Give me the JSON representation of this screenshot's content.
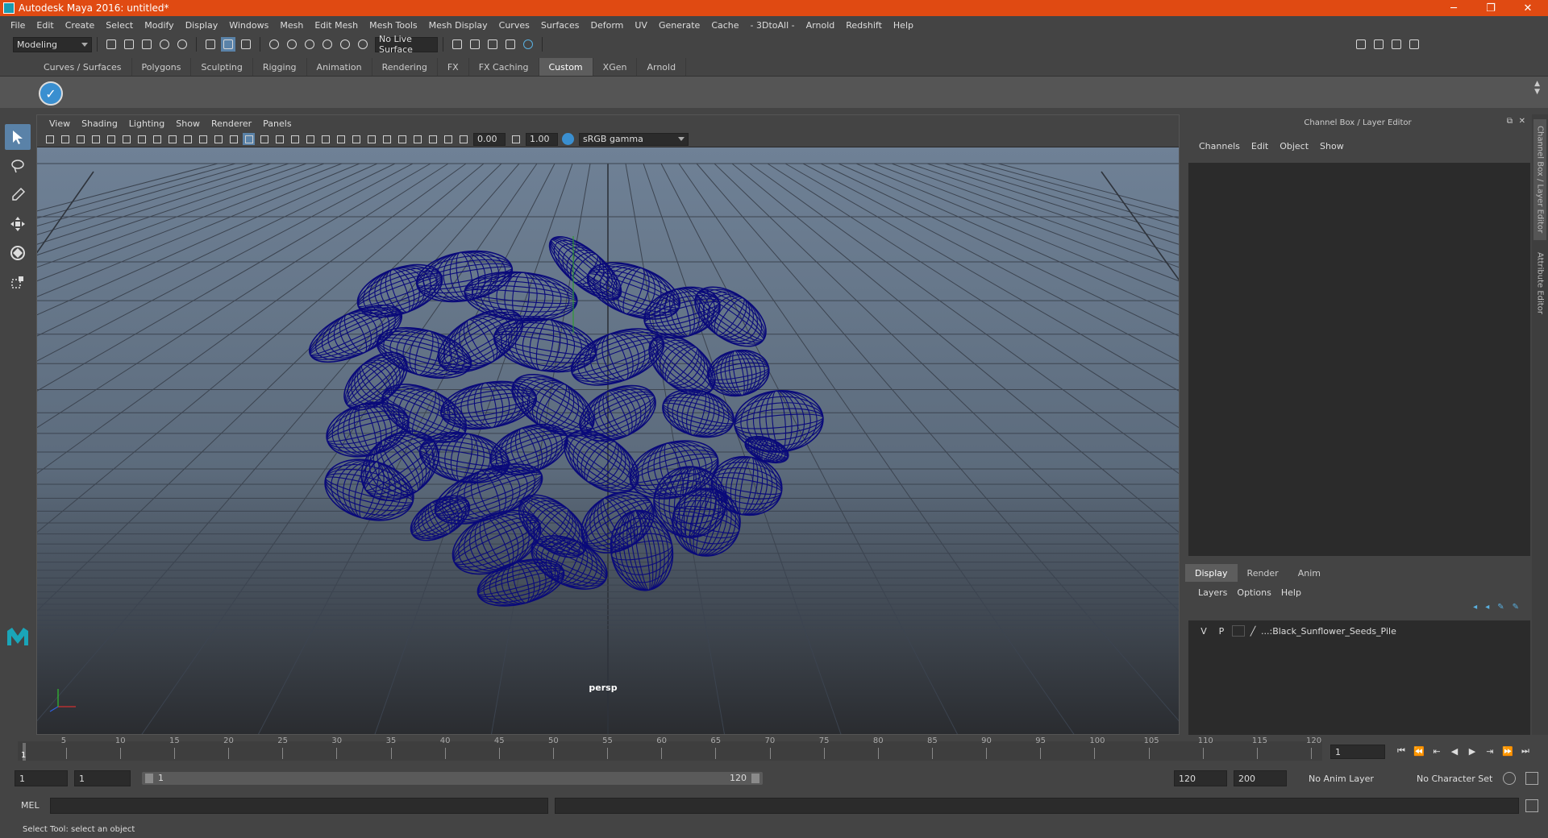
{
  "window": {
    "title": "Autodesk Maya 2016: untitled*",
    "minimize": "─",
    "maximize": "❐",
    "close": "✕"
  },
  "menubar": [
    "File",
    "Edit",
    "Create",
    "Select",
    "Modify",
    "Display",
    "Windows",
    "Mesh",
    "Edit Mesh",
    "Mesh Tools",
    "Mesh Display",
    "Curves",
    "Surfaces",
    "Deform",
    "UV",
    "Generate",
    "Cache",
    "- 3DtoAll -",
    "Arnold",
    "Redshift",
    "Help"
  ],
  "statusline": {
    "mode": "Modeling",
    "live_surface": "No Live Surface"
  },
  "shelf": {
    "tabs": [
      "Curves / Surfaces",
      "Polygons",
      "Sculpting",
      "Rigging",
      "Animation",
      "Rendering",
      "FX",
      "FX Caching",
      "Custom",
      "XGen",
      "Arnold"
    ],
    "active_tab": "Custom"
  },
  "viewport": {
    "menu": [
      "View",
      "Shading",
      "Lighting",
      "Show",
      "Renderer",
      "Panels"
    ],
    "exposure": "0.00",
    "gamma": "1.00",
    "color_space": "sRGB gamma",
    "camera_label": "persp",
    "wire_color": "#0a0a7a",
    "bg_top": "#6f8196",
    "bg_bottom": "#2a2c30"
  },
  "channel_box": {
    "header": "Channel Box / Layer Editor",
    "menu": [
      "Channels",
      "Edit",
      "Object",
      "Show"
    ]
  },
  "layer_editor": {
    "tabs": [
      "Display",
      "Render",
      "Anim"
    ],
    "active_tab": "Display",
    "menu": [
      "Layers",
      "Options",
      "Help"
    ],
    "layers": [
      {
        "v": "V",
        "p": "P",
        "name": "...:Black_Sunflower_Seeds_Pile"
      }
    ]
  },
  "side_tabs": [
    "Channel Box / Layer Editor",
    "Attribute Editor"
  ],
  "timeline": {
    "ticks": [
      5,
      10,
      15,
      20,
      25,
      30,
      35,
      40,
      45,
      50,
      55,
      60,
      65,
      70,
      75,
      80,
      85,
      90,
      95,
      100,
      105,
      110,
      115,
      120
    ],
    "current_frame": "1",
    "frame_field": "1",
    "min": 1,
    "max": 120
  },
  "range": {
    "start": "1",
    "playback_start": "1",
    "slider_start": "1",
    "slider_end": "120",
    "playback_end": "120",
    "end": "200",
    "anim_layer": "No Anim Layer",
    "character_set": "No Character Set"
  },
  "cmd": {
    "label": "MEL"
  },
  "help_line": "Select Tool: select an object"
}
